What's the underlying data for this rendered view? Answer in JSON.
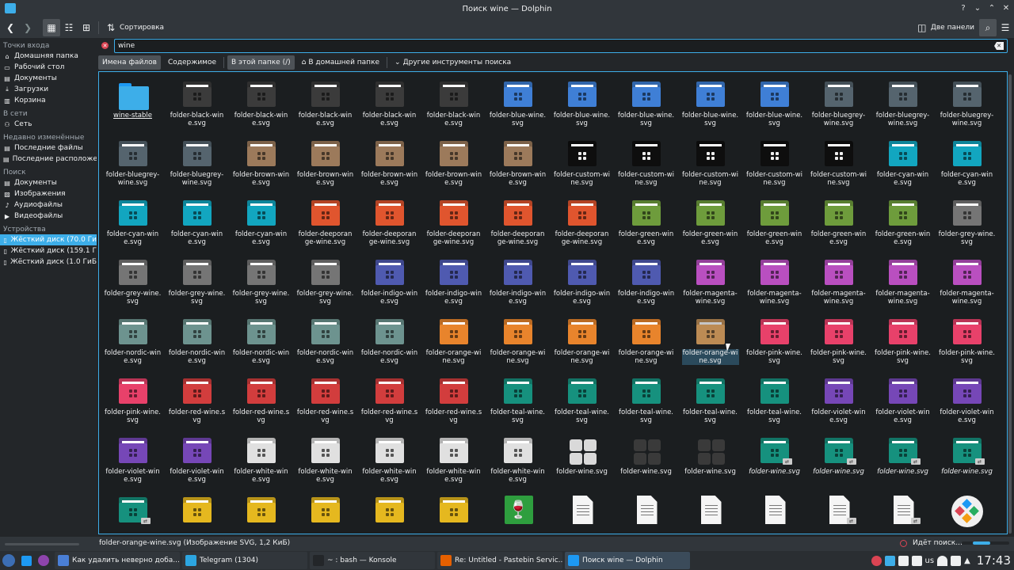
{
  "window": {
    "title": "Поиск wine — Dolphin"
  },
  "toolbar": {
    "sort_label": "Сортировка",
    "split_label": "Две панели"
  },
  "sidebar": {
    "sections": [
      {
        "header": "Точки входа",
        "items": [
          {
            "label": "Домашняя папка",
            "icon": "home-icon"
          },
          {
            "label": "Рабочий стол",
            "icon": "desktop-icon"
          },
          {
            "label": "Документы",
            "icon": "documents-icon"
          },
          {
            "label": "Загрузки",
            "icon": "downloads-icon"
          },
          {
            "label": "Корзина",
            "icon": "trash-icon"
          }
        ]
      },
      {
        "header": "В сети",
        "items": [
          {
            "label": "Сеть",
            "icon": "network-icon"
          }
        ]
      },
      {
        "header": "Недавно изменённые",
        "items": [
          {
            "label": "Последние файлы",
            "icon": "recent-files-icon"
          },
          {
            "label": "Последние расположе",
            "icon": "recent-locations-icon"
          }
        ]
      },
      {
        "header": "Поиск",
        "items": [
          {
            "label": "Документы",
            "icon": "documents-icon"
          },
          {
            "label": "Изображения",
            "icon": "images-icon"
          },
          {
            "label": "Аудиофайлы",
            "icon": "audio-icon"
          },
          {
            "label": "Видеофайлы",
            "icon": "video-icon"
          }
        ]
      },
      {
        "header": "Устройства",
        "items": [
          {
            "label": "Жёсткий диск (70.0 Ги",
            "icon": "disk-icon",
            "selected": true
          },
          {
            "label": "Жёсткий диск (159.1 Г",
            "icon": "disk-icon"
          },
          {
            "label": "Жёсткий диск (1.0 ГиБ",
            "icon": "disk-icon"
          }
        ]
      }
    ]
  },
  "search": {
    "value": "wine"
  },
  "filters": {
    "filenames": "Имена файлов",
    "content": "Содержимое",
    "this_folder": "В этой папке (/)",
    "home_folder": "В домашней папке",
    "more_tools": "Другие инструменты поиска"
  },
  "files": [
    {
      "name": "wine-stable",
      "kind": "plain"
    },
    {
      "name": "folder-black-wine.svg",
      "kind": "folder",
      "color": "#3b3b3b"
    },
    {
      "name": "folder-black-wine.svg",
      "kind": "folder",
      "color": "#3b3b3b"
    },
    {
      "name": "folder-black-wine.svg",
      "kind": "folder",
      "color": "#3b3b3b"
    },
    {
      "name": "folder-black-wine.svg",
      "kind": "folder",
      "color": "#3b3b3b"
    },
    {
      "name": "folder-black-wine.svg",
      "kind": "folder",
      "color": "#3b3b3b"
    },
    {
      "name": "folder-blue-wine.svg",
      "kind": "folder",
      "color": "#3f7fd6"
    },
    {
      "name": "folder-blue-wine.svg",
      "kind": "folder",
      "color": "#3f7fd6"
    },
    {
      "name": "folder-blue-wine.svg",
      "kind": "folder",
      "color": "#3f7fd6"
    },
    {
      "name": "folder-blue-wine.svg",
      "kind": "folder",
      "color": "#3f7fd6"
    },
    {
      "name": "folder-blue-wine.svg",
      "kind": "folder",
      "color": "#3f7fd6"
    },
    {
      "name": "folder-bluegrey-wine.svg",
      "kind": "folder",
      "color": "#55646e"
    },
    {
      "name": "folder-bluegrey-wine.svg",
      "kind": "folder",
      "color": "#55646e"
    },
    {
      "name": "folder-bluegrey-wine.svg",
      "kind": "folder",
      "color": "#55646e"
    },
    {
      "name": "folder-bluegrey-wine.svg",
      "kind": "folder",
      "color": "#55646e"
    },
    {
      "name": "folder-bluegrey-wine.svg",
      "kind": "folder",
      "color": "#55646e"
    },
    {
      "name": "folder-brown-wine.svg",
      "kind": "folder",
      "color": "#9c7a5b"
    },
    {
      "name": "folder-brown-wine.svg",
      "kind": "folder",
      "color": "#9c7a5b"
    },
    {
      "name": "folder-brown-wine.svg",
      "kind": "folder",
      "color": "#9c7a5b"
    },
    {
      "name": "folder-brown-wine.svg",
      "kind": "folder",
      "color": "#9c7a5b"
    },
    {
      "name": "folder-brown-wine.svg",
      "kind": "folder",
      "color": "#9c7a5b"
    },
    {
      "name": "folder-custom-wine.svg",
      "kind": "folder",
      "color": "#0e0e0e"
    },
    {
      "name": "folder-custom-wine.svg",
      "kind": "folder",
      "color": "#0e0e0e"
    },
    {
      "name": "folder-custom-wine.svg",
      "kind": "folder",
      "color": "#0e0e0e"
    },
    {
      "name": "folder-custom-wine.svg",
      "kind": "folder",
      "color": "#0e0e0e"
    },
    {
      "name": "folder-custom-wine.svg",
      "kind": "folder",
      "color": "#0e0e0e"
    },
    {
      "name": "folder-cyan-wine.svg",
      "kind": "folder",
      "color": "#12a6c0"
    },
    {
      "name": "folder-cyan-wine.svg",
      "kind": "folder",
      "color": "#12a6c0"
    },
    {
      "name": "folder-cyan-wine.svg",
      "kind": "folder",
      "color": "#12a6c0"
    },
    {
      "name": "folder-cyan-wine.svg",
      "kind": "folder",
      "color": "#12a6c0"
    },
    {
      "name": "folder-cyan-wine.svg",
      "kind": "folder",
      "color": "#12a6c0"
    },
    {
      "name": "folder-deeporange-wine.svg",
      "kind": "folder",
      "color": "#e0552e"
    },
    {
      "name": "folder-deeporange-wine.svg",
      "kind": "folder",
      "color": "#e0552e"
    },
    {
      "name": "folder-deeporange-wine.svg",
      "kind": "folder",
      "color": "#e0552e"
    },
    {
      "name": "folder-deeporange-wine.svg",
      "kind": "folder",
      "color": "#e0552e"
    },
    {
      "name": "folder-deeporange-wine.svg",
      "kind": "folder",
      "color": "#e0552e"
    },
    {
      "name": "folder-green-wine.svg",
      "kind": "folder",
      "color": "#6e9c3c"
    },
    {
      "name": "folder-green-wine.svg",
      "kind": "folder",
      "color": "#6e9c3c"
    },
    {
      "name": "folder-green-wine.svg",
      "kind": "folder",
      "color": "#6e9c3c"
    },
    {
      "name": "folder-green-wine.svg",
      "kind": "folder",
      "color": "#6e9c3c"
    },
    {
      "name": "folder-green-wine.svg",
      "kind": "folder",
      "color": "#6e9c3c"
    },
    {
      "name": "folder-grey-wine.svg",
      "kind": "folder",
      "color": "#757575"
    },
    {
      "name": "folder-grey-wine.svg",
      "kind": "folder",
      "color": "#757575"
    },
    {
      "name": "folder-grey-wine.svg",
      "kind": "folder",
      "color": "#757575"
    },
    {
      "name": "folder-grey-wine.svg",
      "kind": "folder",
      "color": "#757575"
    },
    {
      "name": "folder-grey-wine.svg",
      "kind": "folder",
      "color": "#757575"
    },
    {
      "name": "folder-indigo-wine.svg",
      "kind": "folder",
      "color": "#4f5ab0"
    },
    {
      "name": "folder-indigo-wine.svg",
      "kind": "folder",
      "color": "#4f5ab0"
    },
    {
      "name": "folder-indigo-wine.svg",
      "kind": "folder",
      "color": "#4f5ab0"
    },
    {
      "name": "folder-indigo-wine.svg",
      "kind": "folder",
      "color": "#4f5ab0"
    },
    {
      "name": "folder-indigo-wine.svg",
      "kind": "folder",
      "color": "#4f5ab0"
    },
    {
      "name": "folder-magenta-wine.svg",
      "kind": "folder",
      "color": "#b94fc0"
    },
    {
      "name": "folder-magenta-wine.svg",
      "kind": "folder",
      "color": "#b94fc0"
    },
    {
      "name": "folder-magenta-wine.svg",
      "kind": "folder",
      "color": "#b94fc0"
    },
    {
      "name": "folder-magenta-wine.svg",
      "kind": "folder",
      "color": "#b94fc0"
    },
    {
      "name": "folder-magenta-wine.svg",
      "kind": "folder",
      "color": "#b94fc0"
    },
    {
      "name": "folder-nordic-wine.svg",
      "kind": "folder",
      "color": "#6d938f"
    },
    {
      "name": "folder-nordic-wine.svg",
      "kind": "folder",
      "color": "#6d938f"
    },
    {
      "name": "folder-nordic-wine.svg",
      "kind": "folder",
      "color": "#6d938f"
    },
    {
      "name": "folder-nordic-wine.svg",
      "kind": "folder",
      "color": "#6d938f"
    },
    {
      "name": "folder-nordic-wine.svg",
      "kind": "folder",
      "color": "#6d938f"
    },
    {
      "name": "folder-orange-wine.svg",
      "kind": "folder",
      "color": "#e8842c"
    },
    {
      "name": "folder-orange-wine.svg",
      "kind": "folder",
      "color": "#e8842c"
    },
    {
      "name": "folder-orange-wine.svg",
      "kind": "folder",
      "color": "#e8842c"
    },
    {
      "name": "folder-orange-wine.svg",
      "kind": "folder",
      "color": "#e8842c"
    },
    {
      "name": "folder-orange-wine.svg",
      "kind": "folder",
      "color": "#f2b066",
      "selected": true
    },
    {
      "name": "folder-pink-wine.svg",
      "kind": "folder",
      "color": "#e8416a"
    },
    {
      "name": "folder-pink-wine.svg",
      "kind": "folder",
      "color": "#e8416a"
    },
    {
      "name": "folder-pink-wine.svg",
      "kind": "folder",
      "color": "#e8416a"
    },
    {
      "name": "folder-pink-wine.svg",
      "kind": "folder",
      "color": "#e8416a"
    },
    {
      "name": "folder-pink-wine.svg",
      "kind": "folder",
      "color": "#e8416a"
    },
    {
      "name": "folder-red-wine.svg",
      "kind": "folder",
      "color": "#d23d3d"
    },
    {
      "name": "folder-red-wine.svg",
      "kind": "folder",
      "color": "#d23d3d"
    },
    {
      "name": "folder-red-wine.svg",
      "kind": "folder",
      "color": "#d23d3d"
    },
    {
      "name": "folder-red-wine.svg",
      "kind": "folder",
      "color": "#d23d3d"
    },
    {
      "name": "folder-red-wine.svg",
      "kind": "folder",
      "color": "#d23d3d"
    },
    {
      "name": "folder-teal-wine.svg",
      "kind": "folder",
      "color": "#16917e"
    },
    {
      "name": "folder-teal-wine.svg",
      "kind": "folder",
      "color": "#16917e"
    },
    {
      "name": "folder-teal-wine.svg",
      "kind": "folder",
      "color": "#16917e"
    },
    {
      "name": "folder-teal-wine.svg",
      "kind": "folder",
      "color": "#16917e"
    },
    {
      "name": "folder-teal-wine.svg",
      "kind": "folder",
      "color": "#16917e"
    },
    {
      "name": "folder-violet-wine.svg",
      "kind": "folder",
      "color": "#7647b7"
    },
    {
      "name": "folder-violet-wine.svg",
      "kind": "folder",
      "color": "#7647b7"
    },
    {
      "name": "folder-violet-wine.svg",
      "kind": "folder",
      "color": "#7647b7"
    },
    {
      "name": "folder-violet-wine.svg",
      "kind": "folder",
      "color": "#7647b7"
    },
    {
      "name": "folder-violet-wine.svg",
      "kind": "folder",
      "color": "#7647b7"
    },
    {
      "name": "folder-white-wine.svg",
      "kind": "folder",
      "color": "#e0e0e0"
    },
    {
      "name": "folder-white-wine.svg",
      "kind": "folder",
      "color": "#e0e0e0"
    },
    {
      "name": "folder-white-wine.svg",
      "kind": "folder",
      "color": "#e0e0e0"
    },
    {
      "name": "folder-white-wine.svg",
      "kind": "folder",
      "color": "#e0e0e0"
    },
    {
      "name": "folder-white-wine.svg",
      "kind": "folder",
      "color": "#e0e0e0"
    },
    {
      "name": "folder-wine.svg",
      "kind": "wine",
      "color": "#d9d9d9"
    },
    {
      "name": "folder-wine.svg",
      "kind": "wine",
      "color": "#3a3a3a"
    },
    {
      "name": "folder-wine.svg",
      "kind": "wine",
      "color": "#3a3a3a"
    },
    {
      "name": "folder-wine.svg",
      "kind": "folder",
      "color": "#16917e",
      "italic": true,
      "link": true
    },
    {
      "name": "folder-wine.svg",
      "kind": "folder",
      "color": "#16917e",
      "italic": true,
      "link": true
    },
    {
      "name": "folder-wine.svg",
      "kind": "folder",
      "color": "#16917e",
      "italic": true,
      "link": true
    },
    {
      "name": "folder-wine.svg",
      "kind": "folder",
      "color": "#16917e",
      "italic": true,
      "link": true
    },
    {
      "name": "",
      "kind": "folder",
      "color": "#16917e",
      "link": true
    },
    {
      "name": "",
      "kind": "folder",
      "color": "#e5b81f"
    },
    {
      "name": "",
      "kind": "folder",
      "color": "#e5b81f"
    },
    {
      "name": "",
      "kind": "folder",
      "color": "#e5b81f"
    },
    {
      "name": "",
      "kind": "folder",
      "color": "#e5b81f"
    },
    {
      "name": "",
      "kind": "folder",
      "color": "#e5b81f"
    },
    {
      "name": "",
      "kind": "app"
    },
    {
      "name": "",
      "kind": "doc"
    },
    {
      "name": "",
      "kind": "doc"
    },
    {
      "name": "",
      "kind": "doc"
    },
    {
      "name": "",
      "kind": "doc"
    },
    {
      "name": "",
      "kind": "doc",
      "link": true
    },
    {
      "name": "",
      "kind": "doc",
      "link": true
    },
    {
      "name": "",
      "kind": "ball"
    }
  ],
  "status": {
    "text": "folder-orange-wine.svg (Изображение SVG, 1,2 КиБ)",
    "busy": "Идёт поиск..."
  },
  "taskbar": {
    "tasks": [
      {
        "label": "Как удалить неверно доба...",
        "icon": "browser-icon",
        "color": "#4a7fd6"
      },
      {
        "label": "Telegram (1304)",
        "icon": "telegram-icon",
        "color": "#2ca5e0"
      },
      {
        "label": "~ : bash — Konsole",
        "icon": "konsole-icon",
        "color": "#232629"
      },
      {
        "label": "Re: Untitled - Pastebin Servic...",
        "icon": "firefox-icon",
        "color": "#e66000"
      },
      {
        "label": "Поиск wine — Dolphin",
        "icon": "dolphin-icon",
        "color": "#1d99f3",
        "active": true
      }
    ],
    "lang": "us",
    "clock": "17:43"
  }
}
